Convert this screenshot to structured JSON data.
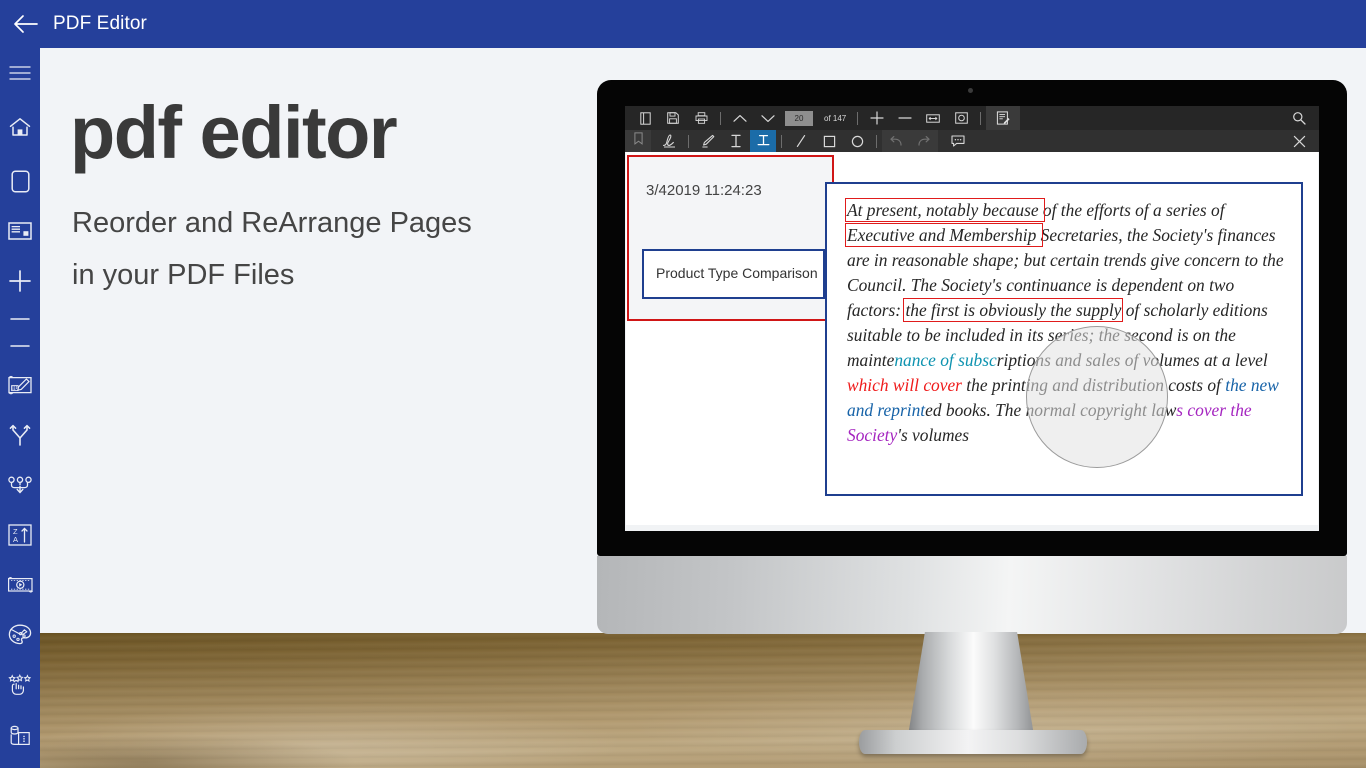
{
  "appbar": {
    "back_icon": "arrow-left-icon",
    "title": "PDF Editor",
    "bg_color": "#25409B"
  },
  "sidebar": {
    "items": [
      {
        "icon": "hamburger-menu-icon",
        "name": "menu"
      },
      {
        "icon": "home-icon",
        "name": "home"
      },
      {
        "icon": "page-icon",
        "name": "page"
      },
      {
        "icon": "card-icon",
        "name": "card"
      },
      {
        "icon": "plus-icon",
        "name": "add"
      },
      {
        "icon": "minus-icon",
        "name": "remove-1"
      },
      {
        "icon": "minus-icon",
        "name": "remove-2"
      },
      {
        "icon": "blueprint-edit-icon",
        "name": "blueprint-edit"
      },
      {
        "icon": "split-arrows-icon",
        "name": "split"
      },
      {
        "icon": "merge-arrows-icon",
        "name": "merge"
      },
      {
        "icon": "sort-za-icon",
        "name": "sort"
      },
      {
        "icon": "media-film-icon",
        "name": "media"
      },
      {
        "icon": "paint-palette-icon",
        "name": "palette"
      },
      {
        "icon": "sparkle-cursor-icon",
        "name": "effects"
      },
      {
        "icon": "stamp-page-icon",
        "name": "stamp"
      }
    ]
  },
  "hero": {
    "headline": "pdf editor",
    "subhead_line1": "Reorder and ReArrange Pages",
    "subhead_line2": "in your PDF Files"
  },
  "pdf_app": {
    "toolbar_primary": {
      "buttons": [
        {
          "icon": "book-open-icon",
          "label": "Open"
        },
        {
          "icon": "save-disk-icon",
          "label": "Save"
        },
        {
          "icon": "print-icon",
          "label": "Print"
        },
        {
          "icon": "chevron-up-icon",
          "label": "Previous Page"
        },
        {
          "icon": "chevron-down-icon",
          "label": "Next Page"
        }
      ],
      "page_number": "20",
      "page_total": "of 147",
      "zoom_in": "+",
      "zoom_out": "−",
      "fit_width_icon": "fit-width-icon",
      "fit_page_icon": "fit-page-icon",
      "annotate_icon": "annotate-page-icon",
      "search_icon": "search-icon"
    },
    "toolbar_secondary": {
      "bookmark_icon": "bookmark-icon",
      "tools": [
        {
          "icon": "signature-icon",
          "name": "signature",
          "active": false,
          "dim": false
        },
        {
          "icon": "highlighter-icon",
          "name": "highlight",
          "active": false,
          "dim": false
        },
        {
          "icon": "text-cursor-icon",
          "name": "text",
          "active": false,
          "dim": false
        },
        {
          "icon": "strikethrough-icon",
          "name": "strikeout",
          "active": true,
          "dim": false
        },
        {
          "icon": "line-icon",
          "name": "line",
          "active": false,
          "dim": false
        },
        {
          "icon": "rectangle-icon",
          "name": "rectangle",
          "active": false,
          "dim": false
        },
        {
          "icon": "ellipse-icon",
          "name": "ellipse",
          "active": false,
          "dim": false
        },
        {
          "icon": "undo-icon",
          "name": "undo",
          "active": false,
          "dim": true
        },
        {
          "icon": "redo-icon",
          "name": "redo",
          "active": false,
          "dim": true
        },
        {
          "icon": "comment-icon",
          "name": "comment",
          "active": false,
          "dim": false
        }
      ],
      "close_icon": "close-icon"
    },
    "document": {
      "timestamp": "3/42019 11:24:23",
      "left_box_label": "Product Type Comparison",
      "paragraph_runs": [
        {
          "text": "At present, notably because ",
          "style": "boxed-red"
        },
        {
          "text": "of the efforts of a series of ",
          "style": "plain"
        },
        {
          "text": "Executive and Membership ",
          "style": "boxed-red"
        },
        {
          "text": " Secretaries, the Society's finances are in reasonable shape; but certain trends give concern to the Council. The Society's continuance is dependent on two factors: ",
          "style": "plain"
        },
        {
          "text": "the first is obviously the supply",
          "style": "boxed-red"
        },
        {
          "text": " of scholarly editions suitable to be included in its series; the second is on the mainte",
          "style": "plain"
        },
        {
          "text": "nance of subsc",
          "style": "teal"
        },
        {
          "text": "riptions and sales of volumes at a level ",
          "style": "plain"
        },
        {
          "text": "which will cover",
          "style": "red"
        },
        {
          "text": " the printing and distribution costs of ",
          "style": "plain"
        },
        {
          "text": "the new and reprint",
          "style": "blue"
        },
        {
          "text": "ed books. The normal copyright law",
          "style": "plain"
        },
        {
          "text": "s cover the Society",
          "style": "purple"
        },
        {
          "text": "'s volumes",
          "style": "plain"
        }
      ],
      "highlight_colors": {
        "box_red": "#e01b1b",
        "box_blue": "#1f3f8f",
        "teal": "#0e93b0",
        "red": "#ef1b1b",
        "blue": "#1763a8",
        "purple": "#a526c0"
      },
      "magnifier": "magnifier-lens"
    }
  }
}
